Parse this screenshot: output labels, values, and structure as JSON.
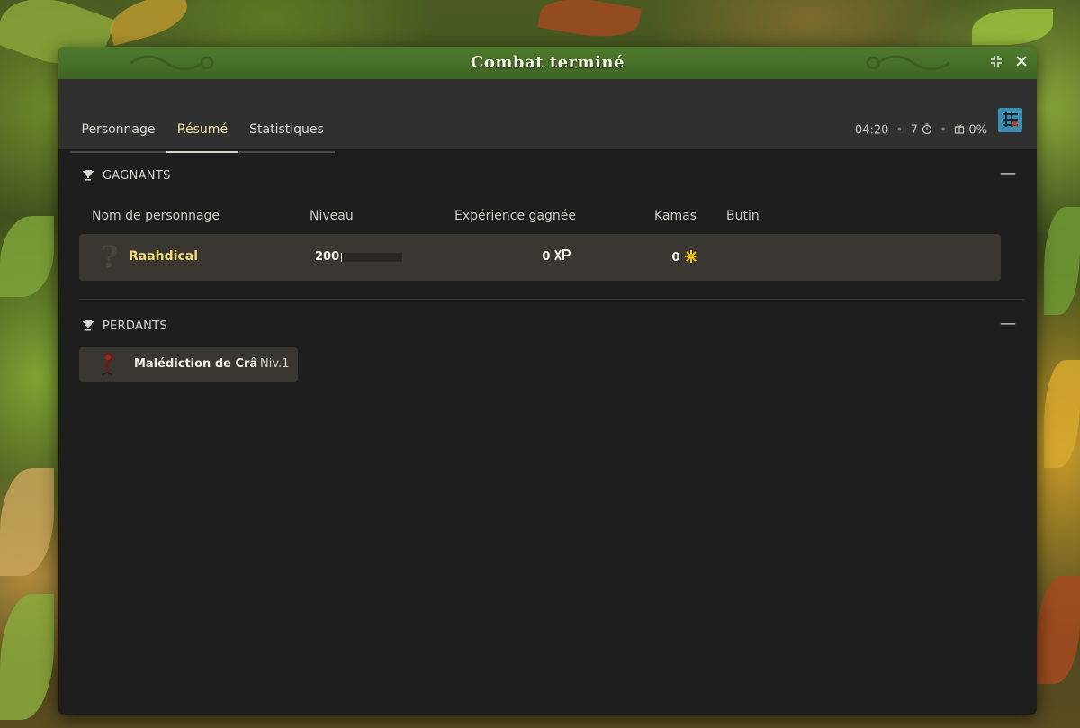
{
  "window": {
    "title": "Combat terminé"
  },
  "tabs": [
    {
      "label": "Personnage",
      "active": false
    },
    {
      "label": "Résumé",
      "active": true
    },
    {
      "label": "Statistiques",
      "active": false
    }
  ],
  "fight_info": {
    "duration": "04:20",
    "turns": "7",
    "percent": "0%"
  },
  "winners": {
    "heading": "GAGNANTS",
    "columns": {
      "name": "Nom de personnage",
      "level": "Niveau",
      "xp": "Expérience gagnée",
      "kamas": "Kamas",
      "loot": "Butin"
    },
    "rows": [
      {
        "name": "Raahdical",
        "level": "200",
        "xp": "0",
        "kamas": "0",
        "level_progress": 0.02
      }
    ]
  },
  "losers": {
    "heading": "PERDANTS",
    "entries": [
      {
        "name": "Malédiction de Crâ",
        "level": "Niv.1"
      }
    ]
  },
  "colors": {
    "title_bar": "#4a7429",
    "active_tab_text": "#f4e3a0",
    "player_name": "#f1dc7a",
    "kamas_icon": "#f2c218",
    "window_bg": "#1e1e1f"
  }
}
